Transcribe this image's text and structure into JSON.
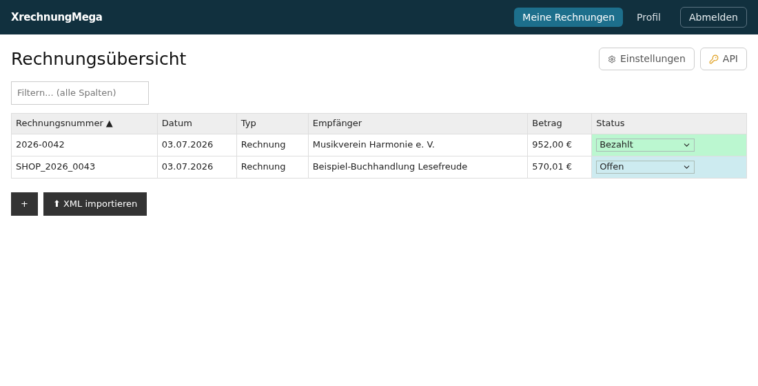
{
  "brand": "XrechnungMega",
  "nav": [
    {
      "label": "Meine Rechnungen",
      "selected": true
    },
    {
      "label": "Profil",
      "selected": false
    }
  ],
  "logout": "Abmelden",
  "title": "Rechnungsübersicht",
  "actions": [
    {
      "kind": "settings",
      "label": "Einstellungen"
    },
    {
      "kind": "key",
      "label": "API"
    }
  ],
  "filter": {
    "placeholder": "Filtern... (alle Spalten)"
  },
  "table": {
    "columns": [
      "Rechnungsnummer ▲",
      "Datum",
      "Typ",
      "Empfänger",
      "Betrag",
      "Status"
    ],
    "rows": [
      {
        "cells": [
          "2026-0042",
          "03.07.2026",
          "Rechnung",
          "Musikverein Harmonie e. V.",
          "952,00 €"
        ],
        "status": "Bezahlt",
        "color": "#bbf7d0"
      },
      {
        "cells": [
          "SHOP_2026_0043",
          "03.07.2026",
          "Rechnung",
          "Beispiel-Buchhandlung Lesefreude",
          "570,01 €"
        ],
        "status": "Offen",
        "color": "#cdebf0"
      }
    ]
  },
  "buttons": [
    "+",
    "⬆ XML importieren"
  ]
}
